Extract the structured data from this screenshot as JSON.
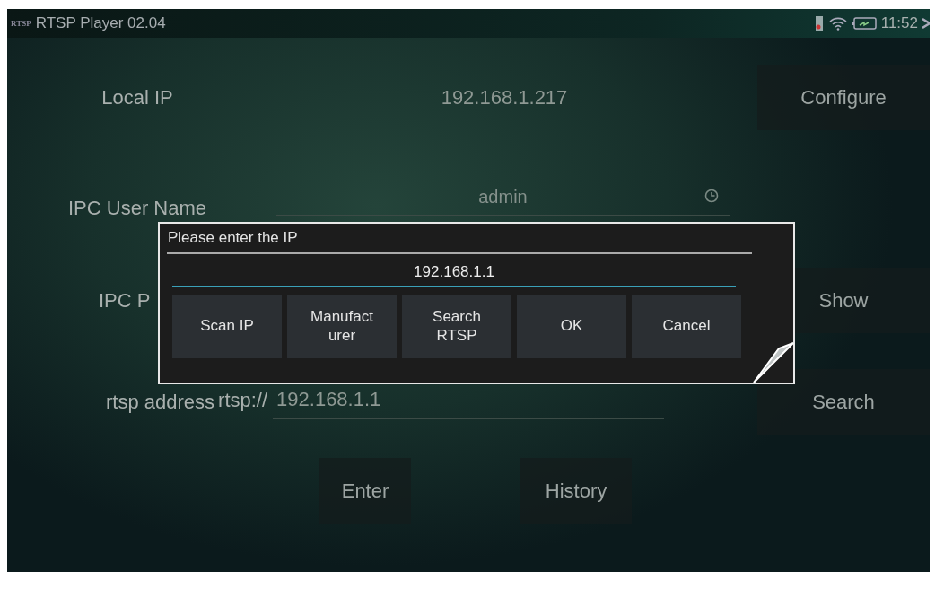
{
  "title_bar": {
    "icon_text": "RTSP",
    "title": "RTSP Player 02.04",
    "time": "11:52"
  },
  "form": {
    "local_ip": {
      "label": "Local IP",
      "value": "192.168.1.217"
    },
    "configure_button": "Configure",
    "user_name": {
      "label": "IPC User Name",
      "value": "admin"
    },
    "password": {
      "label": "IPC P"
    },
    "show_button": "Show",
    "rtsp": {
      "label": "rtsp address",
      "prefix": "rtsp://",
      "value": "192.168.1.1"
    },
    "search_button": "Search"
  },
  "buttons": [
    "Enter",
    "History"
  ],
  "dialog": {
    "title": "Please enter the IP",
    "value": "192.168.1.1",
    "buttons": [
      {
        "label": "Scan IP"
      },
      {
        "label": "Manufacturer"
      },
      {
        "label": "Search RTSP"
      },
      {
        "label": "OK"
      },
      {
        "label": "Cancel"
      }
    ]
  }
}
